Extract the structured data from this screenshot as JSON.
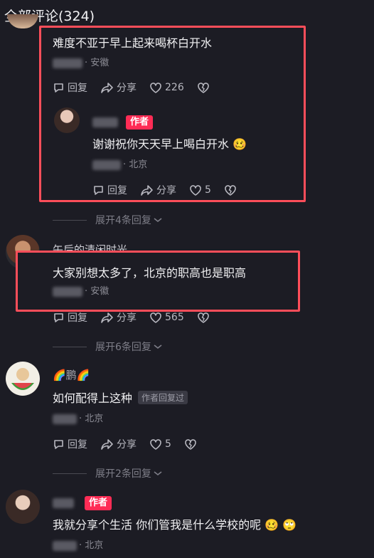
{
  "header": {
    "title": "全部评论(324)"
  },
  "comment1": {
    "text": "难度不亚于早上起来喝杯白开水",
    "location": "· 安徽",
    "reply_label": "回复",
    "share_label": "分享",
    "likes": "226"
  },
  "reply1": {
    "author_badge": "作者",
    "text": "谢谢祝你天天早上喝白开水",
    "emoji": "🥴",
    "location": "· 北京",
    "reply_label": "回复",
    "share_label": "分享",
    "likes": "5"
  },
  "expand1": {
    "label": "展开4条回复"
  },
  "comment2": {
    "nickname": "午后的清闲时光",
    "text": "大家别想太多了，北京的职高也是职高",
    "location": "· 安徽",
    "reply_label": "回复",
    "share_label": "分享",
    "likes": "565"
  },
  "expand2": {
    "label": "展开6条回复"
  },
  "comment3": {
    "nickname": "🌈鹏🌈",
    "text": "如何配得上这种",
    "replied_badge": "作者回复过",
    "location": "· 北京",
    "reply_label": "回复",
    "share_label": "分享",
    "likes": "5"
  },
  "expand3": {
    "label": "展开2条回复"
  },
  "comment4": {
    "author_badge": "作者",
    "text": "我就分享个生活 你们管我是什么学校的呢",
    "emoji1": "🥴",
    "emoji2": "🙄",
    "location": "· 北京"
  },
  "colors": {
    "background": "#1c1c24",
    "highlight_box": "#ff4e5a",
    "author_badge": "#fe2c55"
  }
}
